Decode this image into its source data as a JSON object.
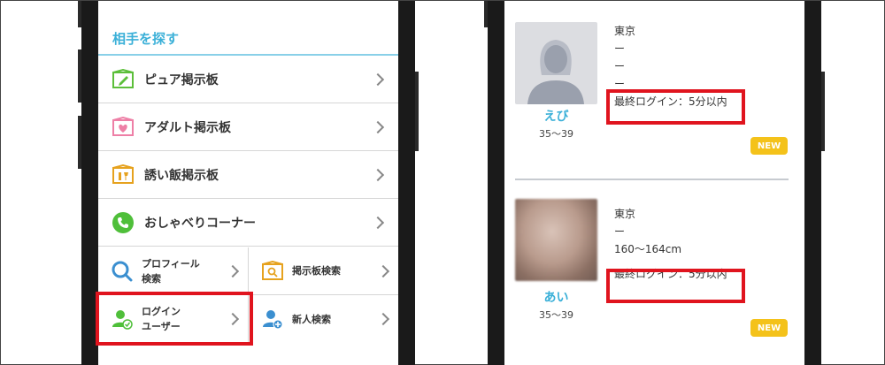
{
  "left_screen": {
    "section_title": "相手を探す",
    "menu": [
      {
        "label": "ピュア掲示板",
        "icon": "pure-board-icon",
        "color": "#5cbf3a"
      },
      {
        "label": "アダルト掲示板",
        "icon": "adult-board-icon",
        "color": "#ee7fa6"
      },
      {
        "label": "誘い飯掲示板",
        "icon": "meal-board-icon",
        "color": "#e6a21e"
      },
      {
        "label": "おしゃべりコーナー",
        "icon": "phone-icon",
        "color": "#4fbf3a"
      }
    ],
    "grid": {
      "profile_search": "プロフィール\n検索",
      "board_search": "掲示板検索",
      "login_users": "ログイン\nユーザー",
      "new_search": "新人検索"
    }
  },
  "right_screen": {
    "profiles": [
      {
        "name": "えび",
        "age": "35～39",
        "location": "東京",
        "line2": "ー",
        "line3": "ー",
        "line4": "ー",
        "last_login": "最終ログイン：5分以内",
        "badge": "NEW"
      },
      {
        "name": "あい",
        "age": "35～39",
        "location": "東京",
        "line2": "ー",
        "line3": "160～164cm",
        "last_login": "最終ログイン：5分以内",
        "badge": "NEW"
      }
    ]
  },
  "colors": {
    "accent": "#3bb0d8",
    "highlight": "#e0141e",
    "badge": "#f4c21a"
  }
}
